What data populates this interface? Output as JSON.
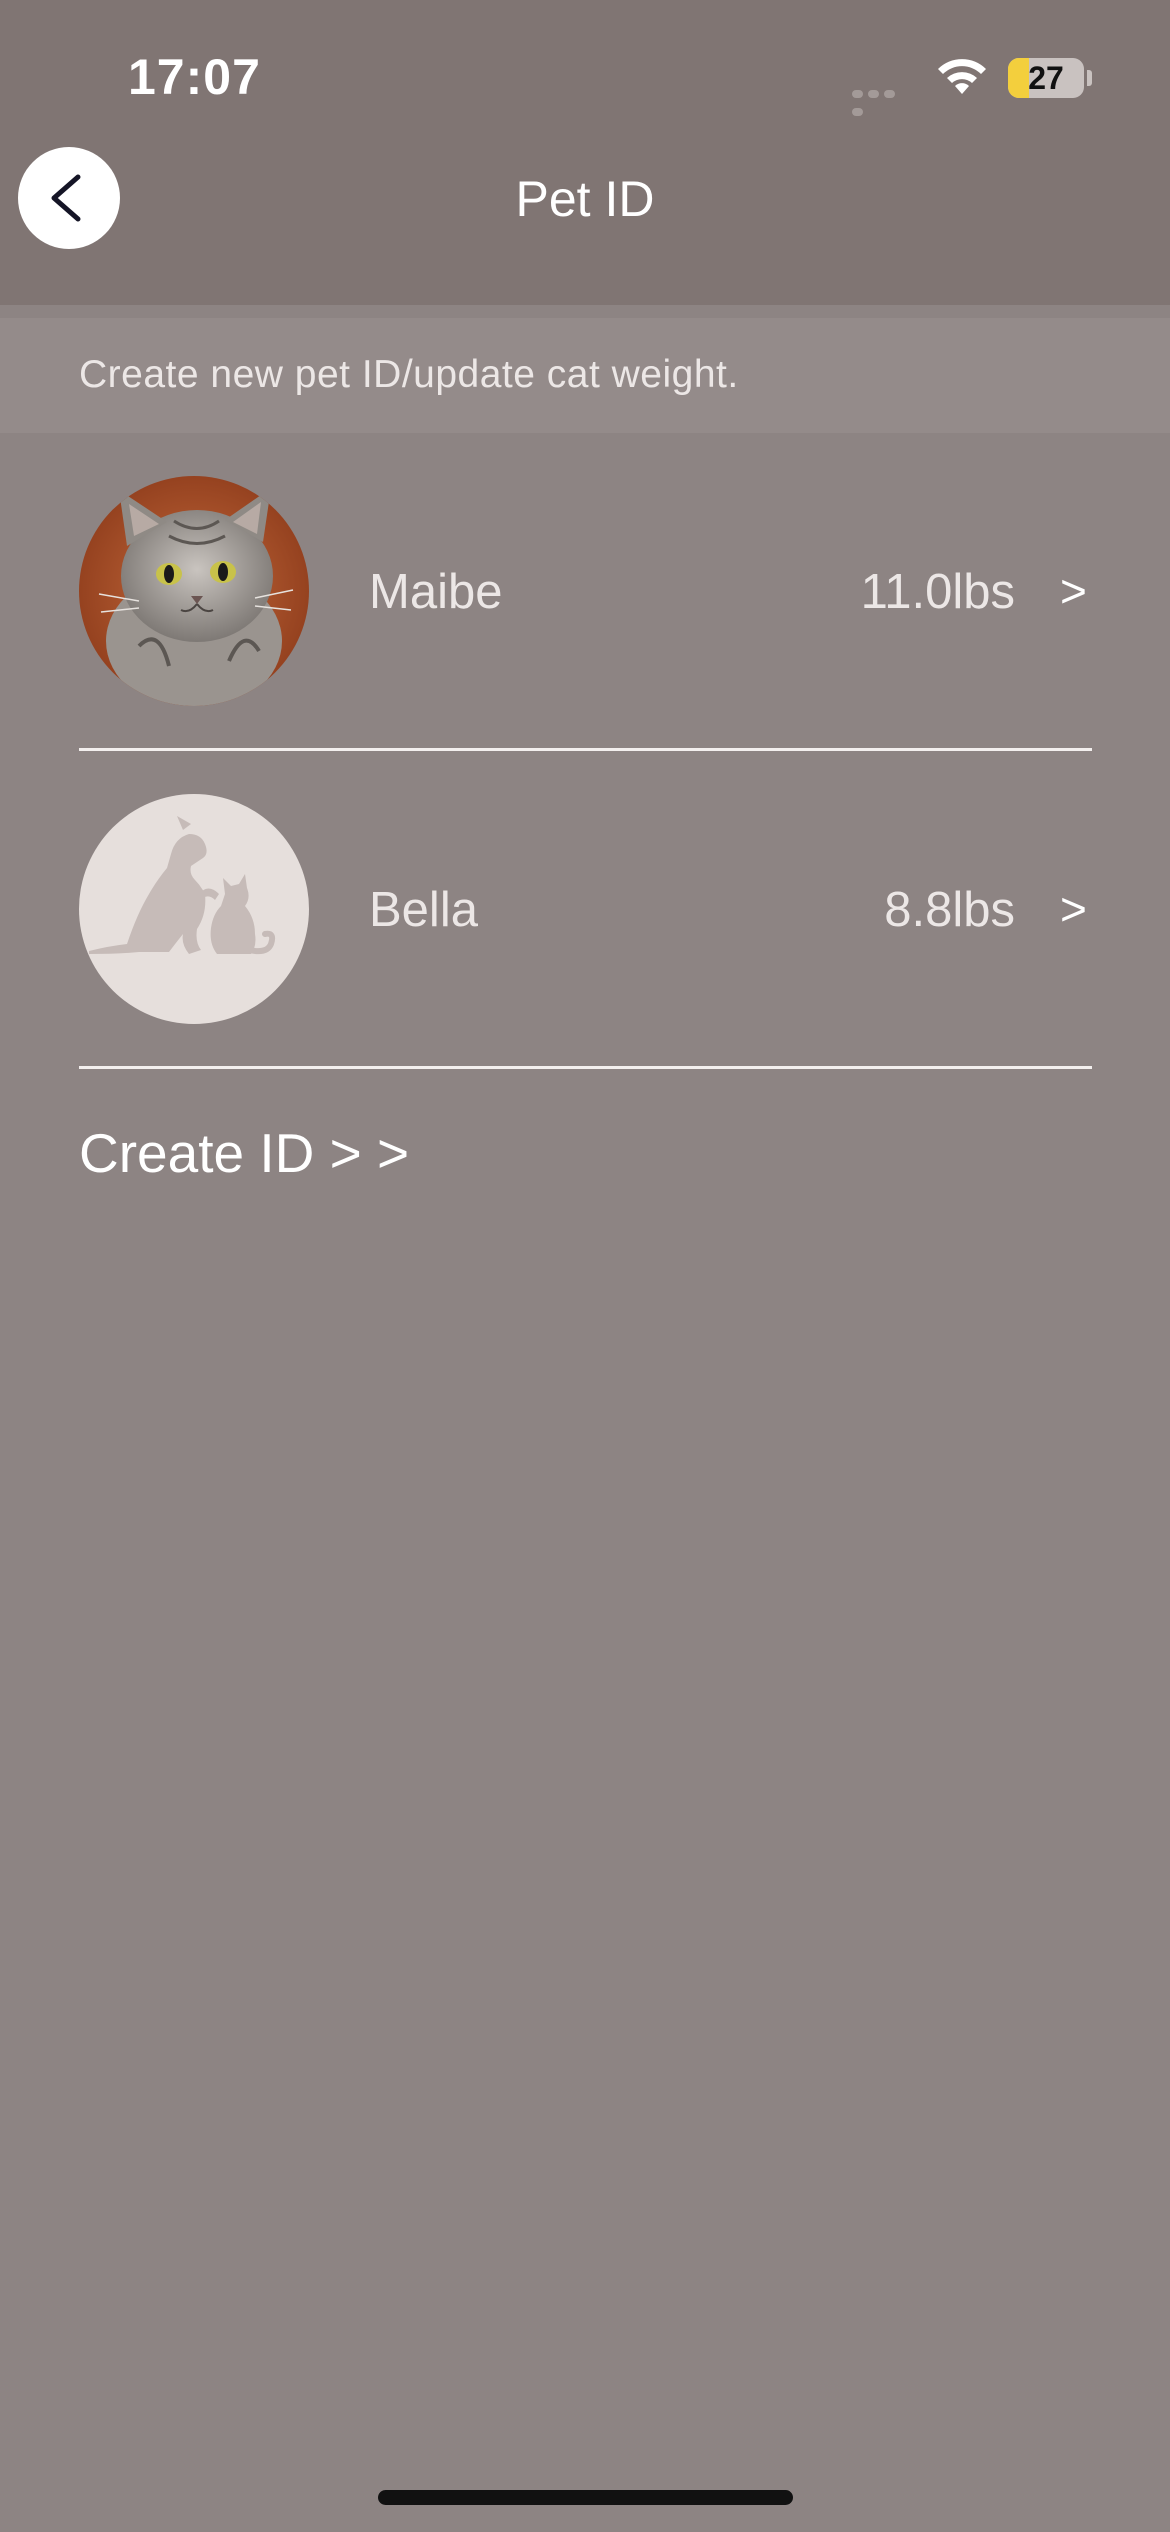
{
  "status_bar": {
    "time": "17:07",
    "battery_level": "27",
    "battery_icon": "battery-icon",
    "wifi_icon": "wifi-icon",
    "signal_icon": "cellular-signal-icon"
  },
  "nav": {
    "title": "Pet ID",
    "back_icon": "chevron-left-icon"
  },
  "info": {
    "text": "Create new pet ID/update cat weight."
  },
  "pets": [
    {
      "name": "Maibe",
      "weight": "11.0lbs",
      "chevron": ">",
      "avatar": "cat-photo"
    },
    {
      "name": "Bella",
      "weight": "8.8lbs",
      "chevron": ">",
      "avatar": "dog-and-cat-silhouette-icon"
    }
  ],
  "create_link": "Create ID > >",
  "colors": {
    "background": "#8d8483",
    "header": "#807573",
    "banner": "#948b8a",
    "accent_battery": "#f3cf3d"
  }
}
